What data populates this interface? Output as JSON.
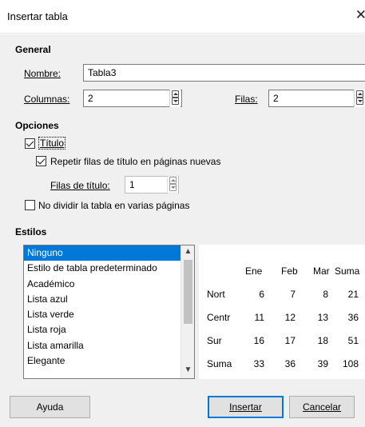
{
  "window": {
    "title": "Insertar tabla",
    "close_glyph": "✕"
  },
  "general": {
    "heading": "General",
    "name_label": "Nombre:",
    "name_value": "Tabla3",
    "columns_label": "Columnas:",
    "columns_value": "2",
    "rows_label": "Filas:",
    "rows_value": "2"
  },
  "options": {
    "heading": "Opciones",
    "title_label": "Título",
    "title_checked": true,
    "repeat_label": "Repetir filas de título en páginas nuevas",
    "repeat_checked": true,
    "header_rows_label": "Filas de título:",
    "header_rows_value": "1",
    "no_split_label": "No dividir la tabla en varias páginas",
    "no_split_checked": false
  },
  "styles": {
    "heading": "Estilos",
    "items": [
      "Ninguno",
      "Estilo de tabla predeterminado",
      "Académico",
      "Lista azul",
      "Lista verde",
      "Lista roja",
      "Lista amarilla",
      "Elegante"
    ],
    "selected_index": 0
  },
  "preview": {
    "col_headers": [
      "Ene",
      "Feb",
      "Mar",
      "Suma"
    ],
    "rows": [
      {
        "label": "Nort",
        "values": [
          "6",
          "7",
          "8",
          "21"
        ]
      },
      {
        "label": "Centr",
        "values": [
          "11",
          "12",
          "13",
          "36"
        ]
      },
      {
        "label": "Sur",
        "values": [
          "16",
          "17",
          "18",
          "51"
        ]
      },
      {
        "label": "Suma",
        "values": [
          "33",
          "36",
          "39",
          "108"
        ]
      }
    ]
  },
  "buttons": {
    "help": "Ayuda",
    "insert": "Insertar",
    "cancel": "Cancelar"
  },
  "colors": {
    "selection": "#0078d7",
    "dialog_bg": "#f0f0f0"
  }
}
